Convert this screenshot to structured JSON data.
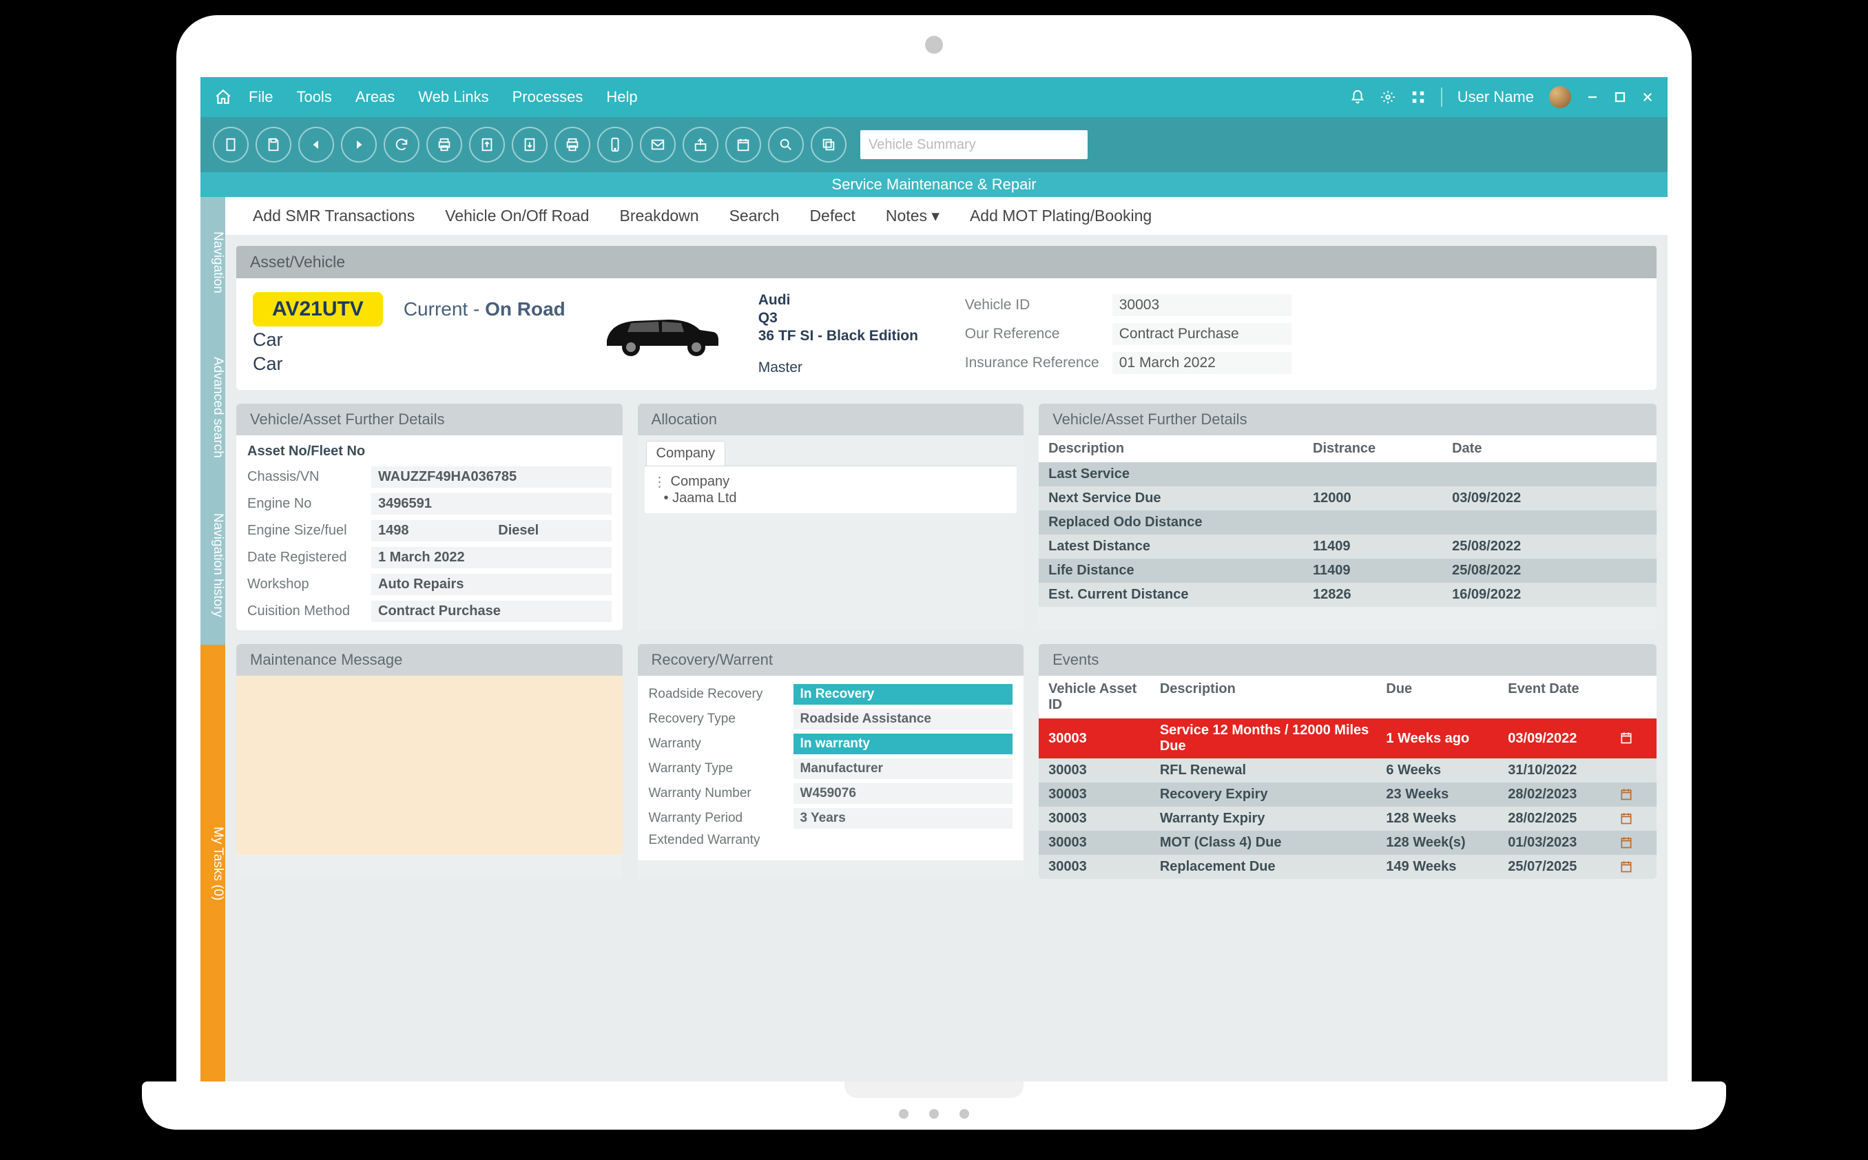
{
  "menubar": {
    "items": [
      "File",
      "Tools",
      "Areas",
      "Web Links",
      "Processes",
      "Help"
    ],
    "username": "User Name"
  },
  "toolbar": {
    "search_placeholder": "Vehicle Summary"
  },
  "context_title": "Service Maintenance & Repair",
  "subnav": [
    "Add SMR Transactions",
    "Vehicle On/Off Road",
    "Breakdown",
    "Search",
    "Defect",
    "Notes ▾",
    "Add MOT Plating/Booking"
  ],
  "siderail": {
    "nav": "Navigation",
    "adv": "Advanced search",
    "his": "Navigation history",
    "tasks": "My Tasks (0)"
  },
  "asset_panel_title": "Asset/Vehicle",
  "asset": {
    "reg": "AV21UTV",
    "status_prefix": "Current - ",
    "status_value": "On Road",
    "type1": "Car",
    "type2": "Car",
    "make": "Audi",
    "model": "Q3",
    "trim": "36 TF SI - Black Edition",
    "contract": "Master",
    "id_labels": [
      "Vehicle ID",
      "Our Reference",
      "Insurance Reference"
    ],
    "id_values": [
      "30003",
      "Contract Purchase",
      "01 March 2022"
    ]
  },
  "details_left": {
    "title": "Vehicle/Asset Further Details",
    "section": "Asset No/Fleet No",
    "rows": [
      {
        "k": "Chassis/VN",
        "v": "WAUZZF49HA036785",
        "v2": ""
      },
      {
        "k": "Engine No",
        "v": "3496591",
        "v2": ""
      },
      {
        "k": "Engine Size/fuel",
        "v": "1498",
        "v2": "Diesel"
      },
      {
        "k": "Date Registered",
        "v": "1 March 2022",
        "v2": ""
      },
      {
        "k": "Workshop",
        "v": "Auto Repairs",
        "v2": ""
      },
      {
        "k": "Cuisition Method",
        "v": "Contract Purchase",
        "v2": ""
      }
    ]
  },
  "allocation": {
    "title": "Allocation",
    "tab": "Company",
    "lines": [
      "Company",
      "Jaama Ltd"
    ]
  },
  "details_right": {
    "title": "Vehicle/Asset Further Details",
    "head": [
      "Description",
      "Distrance",
      "Date"
    ],
    "rows": [
      {
        "d": "Last Service",
        "dist": "",
        "date": ""
      },
      {
        "d": "Next Service Due",
        "dist": "12000",
        "date": "03/09/2022"
      },
      {
        "d": "Replaced Odo Distance",
        "dist": "",
        "date": ""
      },
      {
        "d": "Latest Distance",
        "dist": "11409",
        "date": "25/08/2022"
      },
      {
        "d": "Life Distance",
        "dist": "11409",
        "date": "25/08/2022"
      },
      {
        "d": "Est. Current Distance",
        "dist": "12826",
        "date": "16/09/2022"
      }
    ]
  },
  "maintenance": {
    "title": "Maintenance Message"
  },
  "recovery": {
    "title": "Recovery/Warrent",
    "rows": [
      {
        "k": "Roadside Recovery",
        "type": "pill",
        "v": "In Recovery"
      },
      {
        "k": "Recovery Type",
        "type": "txt",
        "v": "Roadside Assistance"
      },
      {
        "k": "Warranty",
        "type": "pill",
        "v": "In warranty"
      },
      {
        "k": "Warranty Type",
        "type": "txt",
        "v": "Manufacturer"
      },
      {
        "k": "Warranty Number",
        "type": "txt",
        "v": "W459076"
      },
      {
        "k": "Warranty Period",
        "type": "txt",
        "v": "3 Years"
      },
      {
        "k": "Extended Warranty",
        "type": "none",
        "v": ""
      }
    ]
  },
  "events": {
    "title": "Events",
    "head": [
      "Vehicle Asset ID",
      "Description",
      "Due",
      "Event Date"
    ],
    "rows": [
      {
        "cls": "red",
        "id": "30003",
        "d": "Service 12 Months / 12000 Miles Due",
        "due": "1 Weeks ago",
        "date": "03/09/2022",
        "ico": true
      },
      {
        "cls": "a",
        "id": "30003",
        "d": "RFL Renewal",
        "due": "6 Weeks",
        "date": "31/10/2022",
        "ico": false
      },
      {
        "cls": "b",
        "id": "30003",
        "d": "Recovery Expiry",
        "due": "23 Weeks",
        "date": "28/02/2023",
        "ico": true
      },
      {
        "cls": "a",
        "id": "30003",
        "d": "Warranty Expiry",
        "due": "128 Weeks",
        "date": "28/02/2025",
        "ico": true
      },
      {
        "cls": "b",
        "id": "30003",
        "d": "MOT (Class 4) Due",
        "due": "128 Week(s)",
        "date": "01/03/2023",
        "ico": true
      },
      {
        "cls": "a",
        "id": "30003",
        "d": "Replacement Due",
        "due": "149 Weeks",
        "date": "25/07/2025",
        "ico": true
      }
    ]
  }
}
